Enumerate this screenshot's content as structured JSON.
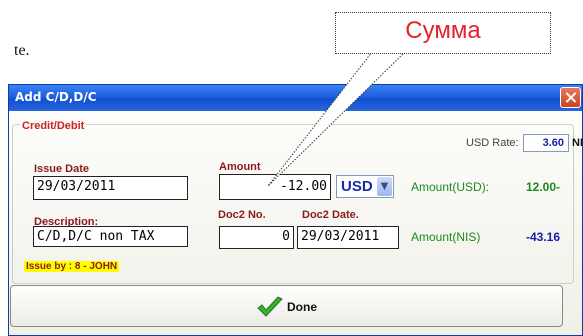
{
  "background": {
    "fragment": "te."
  },
  "callout": {
    "text": "Сумма"
  },
  "window": {
    "title": "Add C/D,D/C",
    "group_title": "Credit/Debit",
    "usd_rate": {
      "label": "USD Rate:",
      "value": "3.60",
      "unit": "NIS"
    },
    "issue_date": {
      "label": "Issue Date",
      "value": "29/03/2011"
    },
    "amount": {
      "label": "Amount",
      "value": "-12.00"
    },
    "currency": {
      "selected": "USD"
    },
    "amount_usd": {
      "label": "Amount(USD):",
      "value": "12.00-"
    },
    "description": {
      "label": "Description:",
      "value": "C/D,D/C non TAX"
    },
    "doc2_no": {
      "label": "Doc2 No.",
      "value": "0"
    },
    "doc2_date": {
      "label": "Doc2 Date.",
      "value": "29/03/2011"
    },
    "amount_nis": {
      "label": "Amount(NIS)",
      "value": "-43.16"
    },
    "issue_by": "Issue by : 8 - JOHN",
    "done_label": "Done"
  },
  "icons": {
    "close": "close-icon",
    "check": "check-icon",
    "dropdown": "chevron-down-icon"
  },
  "colors": {
    "title_bar": "#1f5fdd",
    "label_red": "#8b1a1a",
    "value_green": "#1a8a1a",
    "value_blue": "#1a1ab0",
    "callout_text": "#e5232b"
  }
}
